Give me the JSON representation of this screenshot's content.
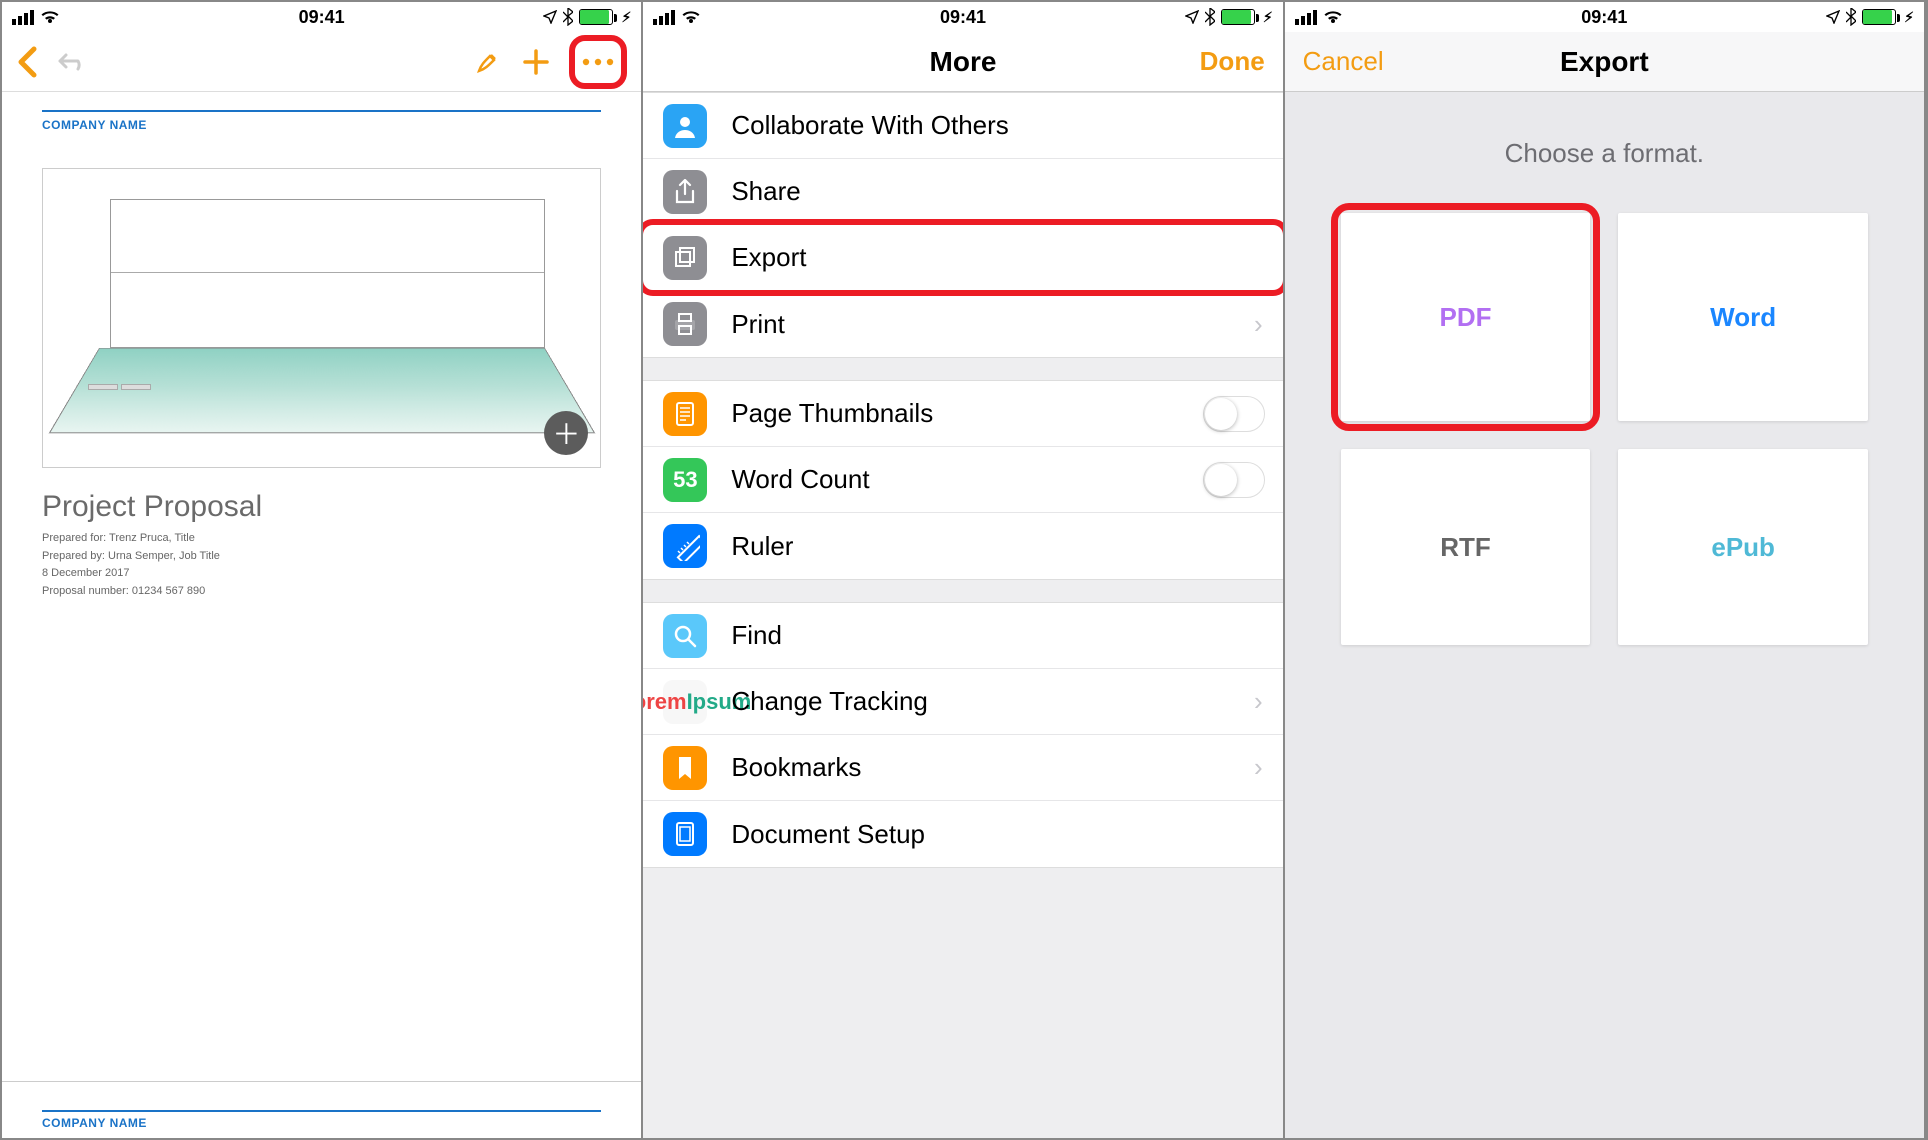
{
  "status": {
    "time": "09:41"
  },
  "panel1": {
    "doc": {
      "company": "COMPANY NAME",
      "title": "Project Proposal",
      "meta1": "Prepared for: Trenz Pruca, Title",
      "meta2": "Prepared by: Urna Semper, Job Title",
      "meta3": "8 December 2017",
      "meta4": "Proposal number: 01234 567 890",
      "footer_company": "COMPANY NAME"
    }
  },
  "panel2": {
    "title": "More",
    "done": "Done",
    "items": {
      "collaborate": "Collaborate With Others",
      "share": "Share",
      "export": "Export",
      "print": "Print",
      "thumbs": "Page Thumbnails",
      "wordcount": "Word Count",
      "wordcount_badge": "53",
      "ruler": "Ruler",
      "find": "Find",
      "change": "Change Tracking",
      "bookmarks": "Bookmarks",
      "docsetup": "Document Setup"
    }
  },
  "panel3": {
    "cancel": "Cancel",
    "title": "Export",
    "choose": "Choose a format.",
    "formats": {
      "pdf": "PDF",
      "word": "Word",
      "rtf": "RTF",
      "epub": "ePub"
    }
  }
}
